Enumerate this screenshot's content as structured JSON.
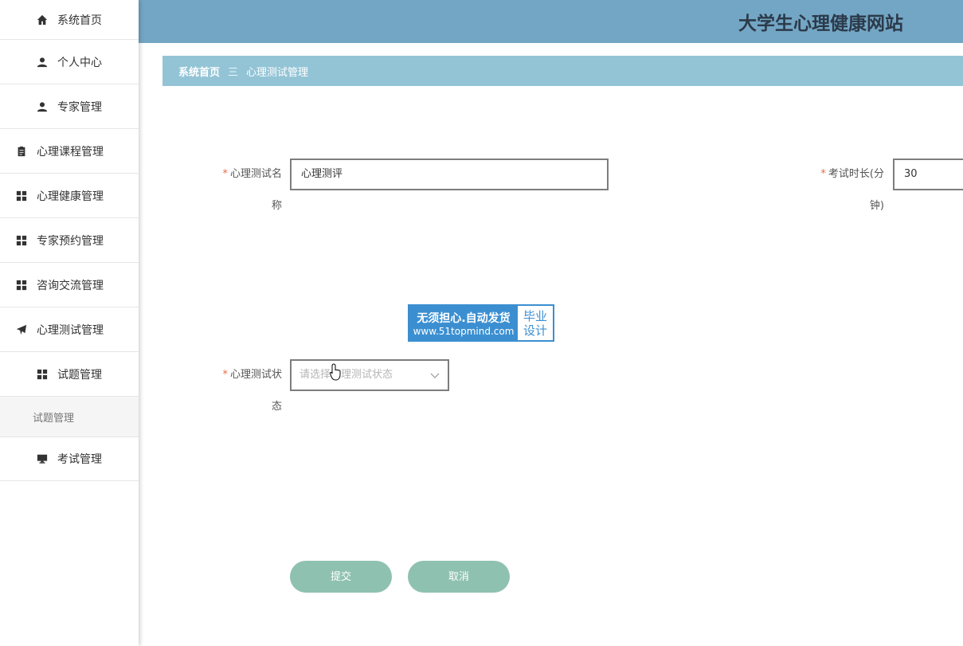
{
  "site": {
    "title": "大学生心理健康网站"
  },
  "sidebar": {
    "items": [
      {
        "label": "系统首页",
        "icon": "home-icon"
      },
      {
        "label": "个人中心",
        "icon": "user-icon"
      },
      {
        "label": "专家管理",
        "icon": "user-icon"
      },
      {
        "label": "心理课程管理",
        "icon": "clipboard-icon"
      },
      {
        "label": "心理健康管理",
        "icon": "grid-icon"
      },
      {
        "label": "专家预约管理",
        "icon": "grid-icon"
      },
      {
        "label": "咨询交流管理",
        "icon": "grid-icon"
      },
      {
        "label": "心理测试管理",
        "icon": "paper-plane-icon"
      },
      {
        "label": "试题管理",
        "icon": "grid-icon"
      },
      {
        "label": "考试管理",
        "icon": "monitor-icon"
      }
    ],
    "subitem": "试题管理"
  },
  "breadcrumb": {
    "home": "系统首页",
    "separator": "三",
    "current": "心理测试管理"
  },
  "form": {
    "name": {
      "label_line1": "心理测试名",
      "label_line2": "称",
      "value": "心理测评",
      "required": "*"
    },
    "duration": {
      "label_line1": "考试时长(分",
      "label_line2": "钟)",
      "value": "30",
      "required": "*"
    },
    "status": {
      "label_line1": "心理测试状",
      "label_line2": "态",
      "placeholder": "请选择心理测试状态",
      "required": "*"
    }
  },
  "watermark": {
    "line1": "无须担心.自动发货",
    "line2": "www.51topmind.com",
    "right1": "毕业",
    "right2": "设计"
  },
  "buttons": {
    "submit": "提交",
    "cancel": "取消"
  }
}
